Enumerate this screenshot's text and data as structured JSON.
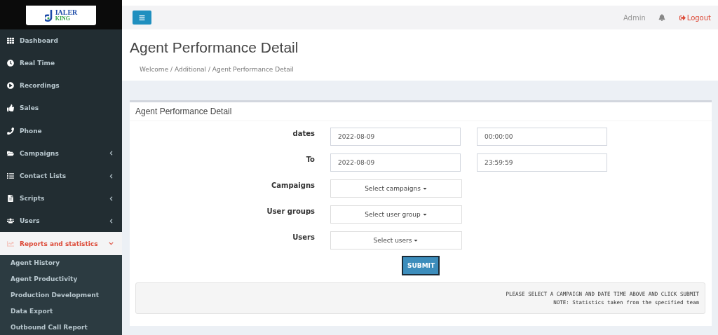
{
  "logo": {
    "word": "IALER",
    "subword": "KING"
  },
  "sidebar": {
    "items": [
      {
        "label": "Dashboard",
        "selected": false
      },
      {
        "label": "Real Time",
        "selected": false
      },
      {
        "label": "Recordings",
        "selected": false
      },
      {
        "label": "Sales",
        "selected": false
      },
      {
        "label": "Phone",
        "selected": false
      },
      {
        "label": "Campaigns",
        "expanded": false,
        "selected": false
      },
      {
        "label": "Contact Lists",
        "expanded": false,
        "selected": false
      },
      {
        "label": "Scripts",
        "expanded": false,
        "selected": false
      },
      {
        "label": "Users",
        "expanded": false,
        "selected": false
      },
      {
        "label": "Reports and statistics",
        "expanded": true,
        "selected": true,
        "children": [
          {
            "label": "Agent History"
          },
          {
            "label": "Agent Productivity"
          },
          {
            "label": "Production Development"
          },
          {
            "label": "Data Export"
          },
          {
            "label": "Outbound Call Report"
          }
        ]
      }
    ]
  },
  "topbar": {
    "user": "Admin",
    "logout": "Logout"
  },
  "page": {
    "title": "Agent Performance Detail",
    "breadcrumb": "Welcome / Additional / Agent Performance Detail"
  },
  "card": {
    "title": "Agent Performance Detail",
    "rows": [
      {
        "label": "dates",
        "fields": [
          {
            "kind": "input",
            "value": "2022-08-09"
          },
          {
            "kind": "input",
            "value": "00:00:00"
          }
        ]
      },
      {
        "label": "To",
        "fields": [
          {
            "kind": "input",
            "value": "2022-08-09"
          },
          {
            "kind": "input",
            "value": "23:59:59"
          }
        ]
      },
      {
        "label": "Campaigns",
        "fields": [
          {
            "kind": "dropdown",
            "value": "Select campaigns"
          }
        ]
      },
      {
        "label": "User groups",
        "fields": [
          {
            "kind": "dropdown",
            "value": "Select user group"
          }
        ]
      },
      {
        "label": "Users",
        "fields": [
          {
            "kind": "dropdown",
            "value": "Select users"
          }
        ]
      }
    ],
    "submit": "SUBMIT",
    "notice": [
      "PLEASE SELECT A CAMPAIGN AND DATE TIME ABOVE AND CLICK SUBMIT",
      "NOTE: Statistics taken from the specified team"
    ]
  }
}
